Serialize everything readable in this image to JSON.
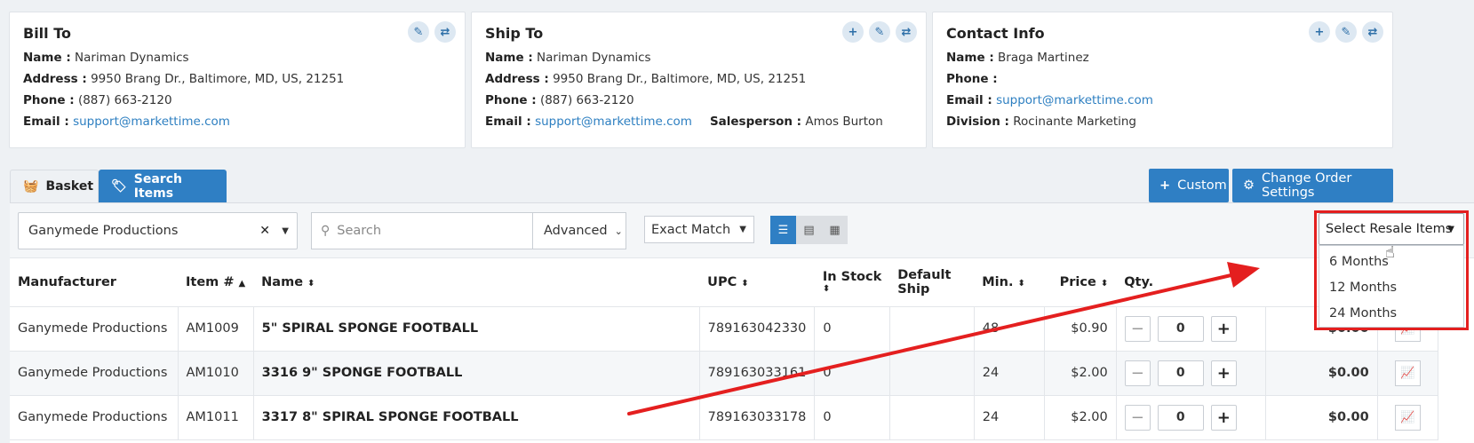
{
  "bill_to": {
    "title": "Bill To",
    "name_label": "Name :",
    "name": "Nariman Dynamics",
    "address_label": "Address :",
    "address": "9950 Brang Dr., Baltimore, MD, US, 21251",
    "phone_label": "Phone :",
    "phone": "(887) 663-2120",
    "email_label": "Email :",
    "email": "support@markettime.com"
  },
  "ship_to": {
    "title": "Ship To",
    "name_label": "Name :",
    "name": "Nariman Dynamics",
    "address_label": "Address :",
    "address": "9950 Brang Dr., Baltimore, MD, US, 21251",
    "phone_label": "Phone :",
    "phone": "(887) 663-2120",
    "email_label": "Email :",
    "email": "support@markettime.com",
    "salesperson_label": "Salesperson :",
    "salesperson": "Amos Burton"
  },
  "contact": {
    "title": "Contact Info",
    "name_label": "Name :",
    "name": "Braga Martinez",
    "phone_label": "Phone :",
    "phone": "",
    "email_label": "Email :",
    "email": "support@markettime.com",
    "division_label": "Division :",
    "division": "Rocinante Marketing"
  },
  "tabs": {
    "basket": "Basket",
    "search_items": "Search Items"
  },
  "buttons": {
    "custom": "Custom",
    "change_order_settings": "Change Order Settings"
  },
  "toolbar": {
    "manufacturer": "Ganymede Productions",
    "search_placeholder": "Search",
    "advanced": "Advanced",
    "match": "Exact Match"
  },
  "table": {
    "headers": {
      "manufacturer": "Manufacturer",
      "item": "Item #",
      "name": "Name",
      "upc": "UPC",
      "in_stock": "In Stock",
      "default_ship_1": "Default",
      "default_ship_2": "Ship",
      "min": "Min.",
      "price": "Price",
      "qty": "Qty."
    },
    "rows": [
      {
        "manufacturer": "Ganymede Productions",
        "item": "AM1009",
        "name": "5\" SPIRAL SPONGE FOOTBALL",
        "upc": "789163042330",
        "in_stock": "0",
        "min": "48",
        "price": "$0.90",
        "qty": "0",
        "total": "$0.00"
      },
      {
        "manufacturer": "Ganymede Productions",
        "item": "AM1010",
        "name": "3316 9\" SPONGE FOOTBALL",
        "upc": "789163033161",
        "in_stock": "0",
        "min": "24",
        "price": "$2.00",
        "qty": "0",
        "total": "$0.00"
      },
      {
        "manufacturer": "Ganymede Productions",
        "item": "AM1011",
        "name": "3317 8\" SPIRAL SPONGE FOOTBALL",
        "upc": "789163033178",
        "in_stock": "0",
        "min": "24",
        "price": "$2.00",
        "qty": "0",
        "total": "$0.00"
      }
    ]
  },
  "resale": {
    "label": "Select Resale Items",
    "options": [
      "6 Months",
      "12 Months",
      "24 Months"
    ]
  },
  "colors": {
    "primary": "#2f7fc4",
    "annotation": "#e41f1f",
    "link": "#2d7fc1"
  }
}
